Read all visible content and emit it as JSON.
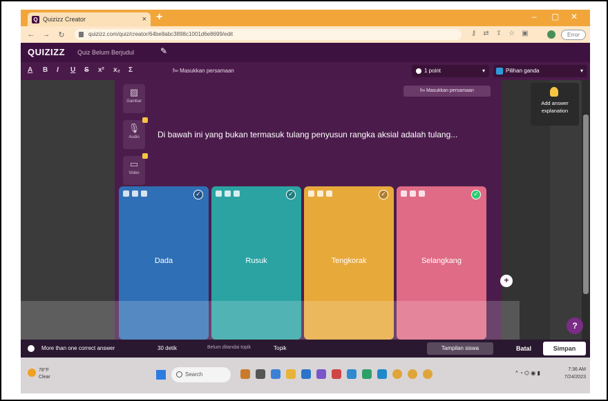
{
  "browser": {
    "tab_title": "Quizizz Creator",
    "tab_close": "×",
    "new_tab": "+",
    "url": "quizizz.com/quiz/creator/64be8abc3898c1001d6e8699/edit",
    "profile_label": "Error"
  },
  "header": {
    "logo": "QUIZIZZ",
    "quiz_name": "Quiz Belum Berjudul"
  },
  "toolbar": {
    "format_items": [
      "A",
      "B",
      "I",
      "U",
      "S",
      "x²",
      "x₂",
      "Σ"
    ],
    "equation_label": "f∞ Masukkan persamaan",
    "points_label": "1 point",
    "question_type": "Pilihan ganda"
  },
  "editor": {
    "media": [
      {
        "label": "Gambar",
        "icon": "image-icon"
      },
      {
        "label": "Audio",
        "icon": "microphone-icon"
      },
      {
        "label": "Video",
        "icon": "video-icon"
      }
    ],
    "equation_button": "f∞ Masukkan persamaan",
    "question_text": "Di bawah ini yang bukan termasuk tulang penyusun rangka aksial adalah tulang...",
    "answers": [
      {
        "label": "Dada",
        "color": "#2f6fb5",
        "correct": false
      },
      {
        "label": "Rusuk",
        "color": "#2ba3a3",
        "correct": false
      },
      {
        "label": "Tengkorak",
        "color": "#e8a93b",
        "correct": false
      },
      {
        "label": "Selangkang",
        "color": "#e06b86",
        "correct": true
      }
    ],
    "add_answer_explanation": "Add answer explanation",
    "help": "?"
  },
  "bottom_bar": {
    "multi_correct": "More than one correct answer",
    "time": "30 detik",
    "tag_placeholder": "Belum ditandai topik",
    "topic": "Topik",
    "preview": "Tampilan siswa",
    "cancel": "Batal",
    "save": "Simpan"
  },
  "taskbar": {
    "temperature": "78°F",
    "weather": "Clear",
    "search": "Search",
    "time": "7:36 AM",
    "date": "7/24/2023"
  },
  "colors": {
    "brand_dark": "#3e1240",
    "panel": "#4b1c4b",
    "browser_accent": "#f2a63a"
  }
}
